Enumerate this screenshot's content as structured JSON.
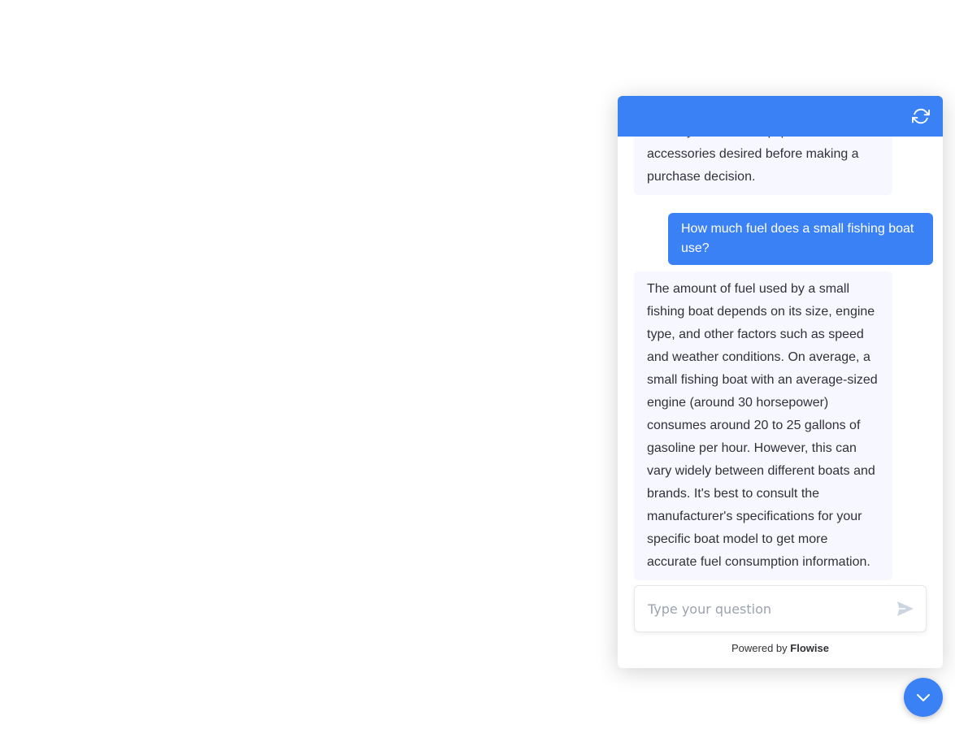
{
  "chat": {
    "messages": [
      {
        "role": "bot",
        "text": "and any additional equipment or accessories desired before making a purchase decision."
      },
      {
        "role": "user",
        "text": "How much fuel does a small fishing boat use?"
      },
      {
        "role": "bot",
        "text": "The amount of fuel used by a small fishing boat depends on its size, engine type, and other factors such as speed and weather conditions. On average, a small fishing boat with an average-sized engine (around 30 horsepower) consumes around 20 to 25 gallons of gasoline per hour. However, this can vary widely between different boats and brands. It's best to consult the manufacturer's specifications for your specific boat model to get more accurate fuel consumption information."
      }
    ],
    "input": {
      "placeholder": "Type your question",
      "value": ""
    },
    "footer": {
      "prefix": "Powered by",
      "brand": "Flowise"
    }
  },
  "icons": {
    "reset": "refresh-icon",
    "send": "send-icon",
    "toggle": "chevron-down-icon"
  },
  "colors": {
    "accent": "#3b81f6",
    "bot_bubble": "#f7f8ff",
    "text": "#303235"
  }
}
